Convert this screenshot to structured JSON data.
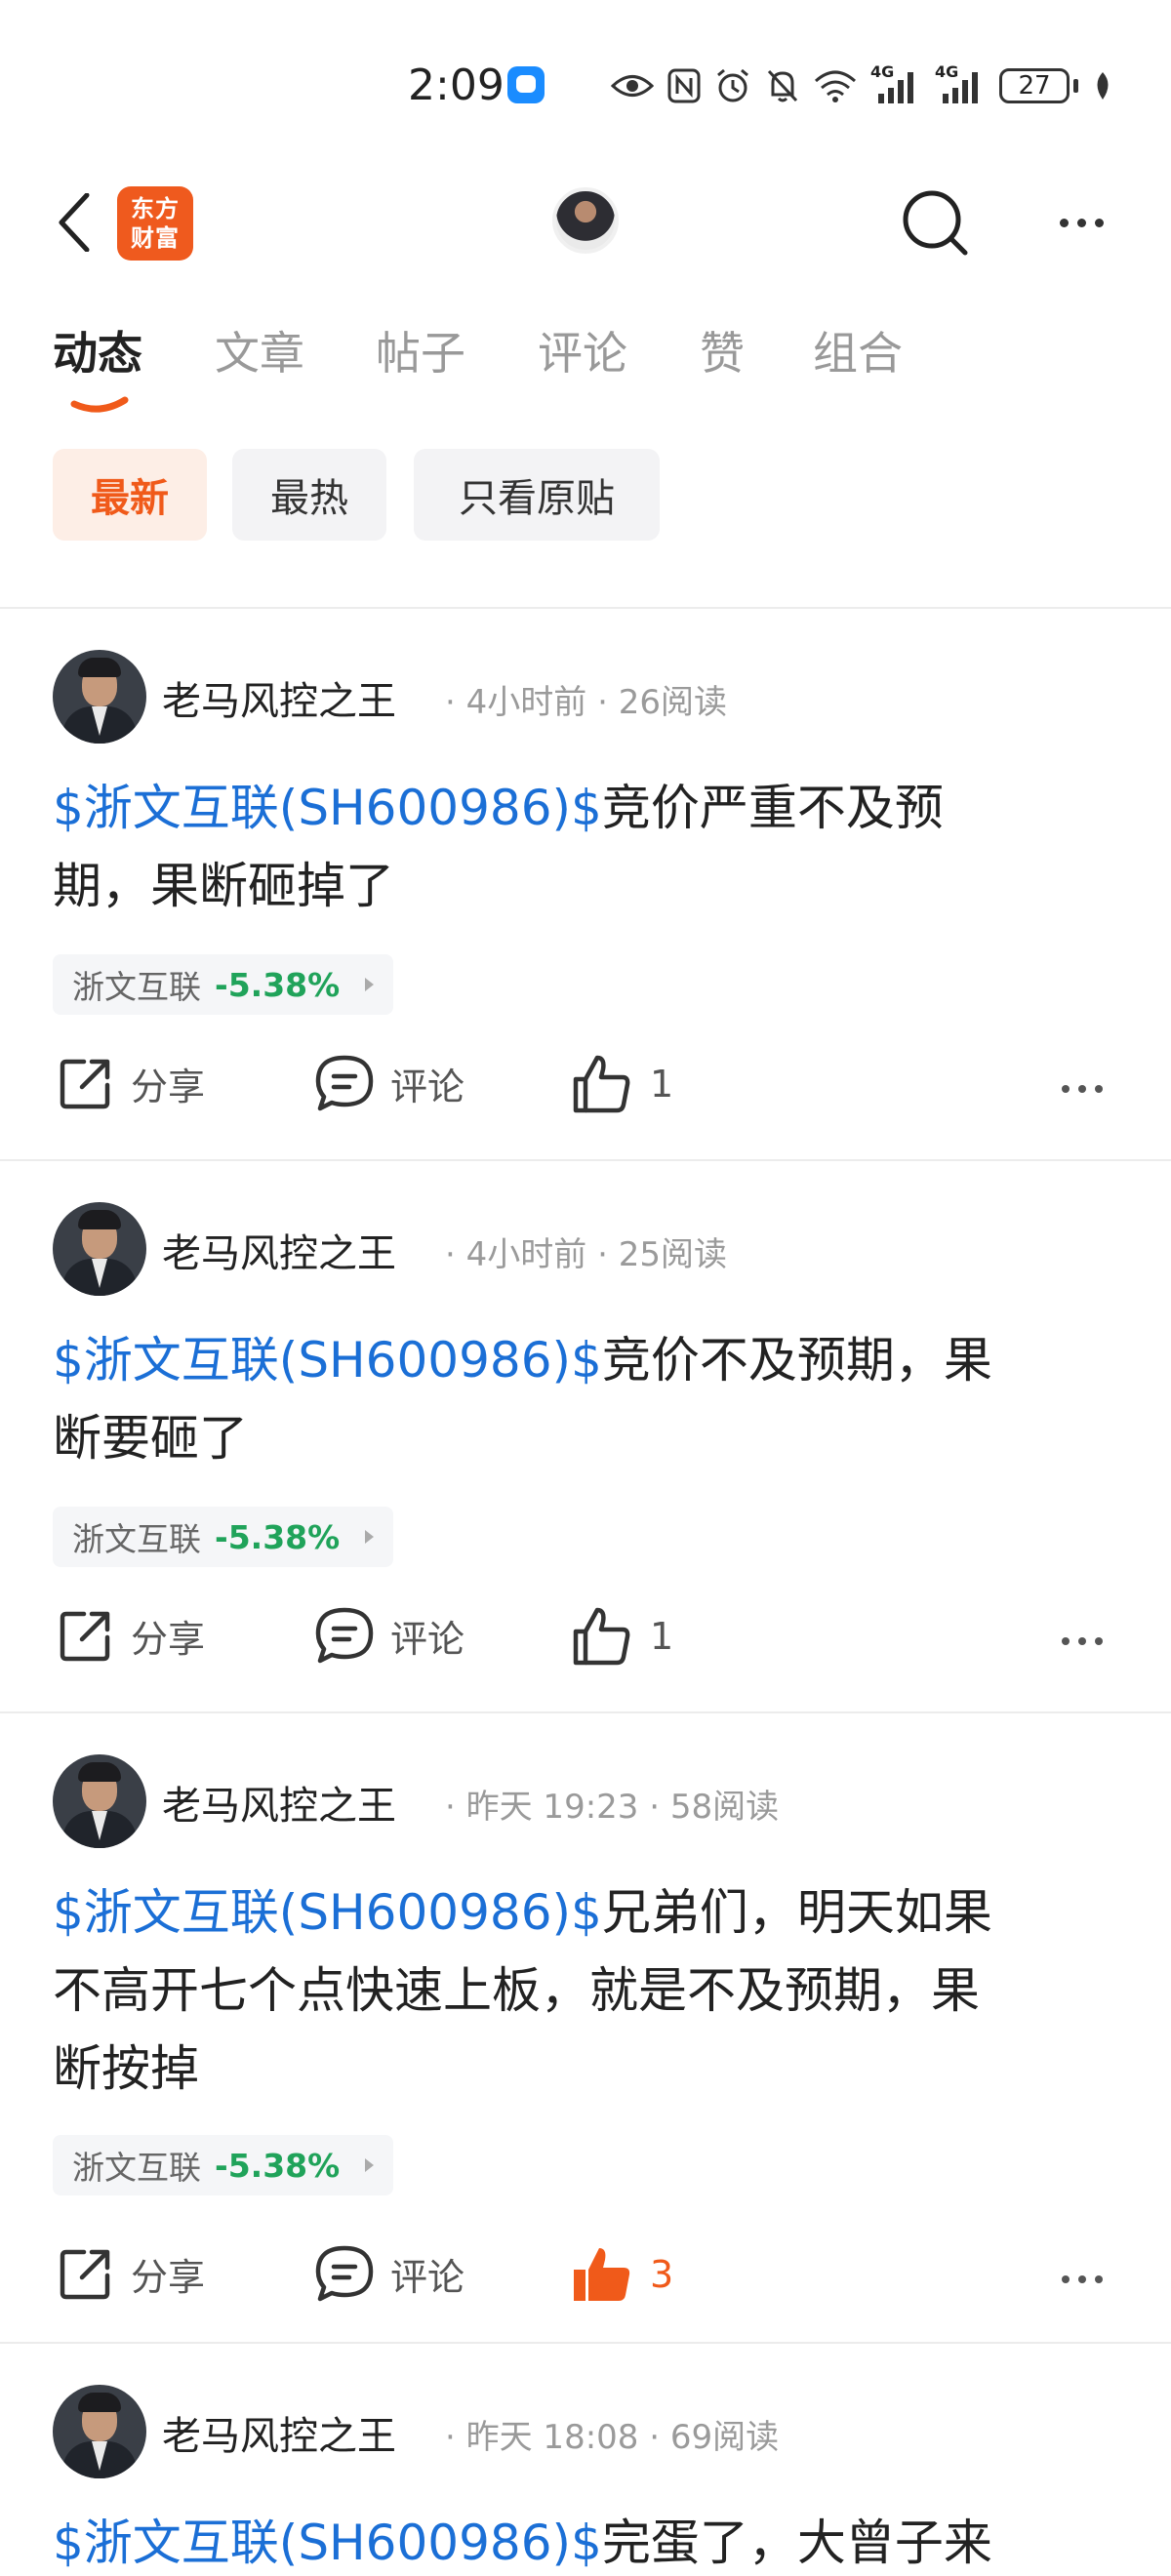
{
  "status_bar": {
    "time": "2:09",
    "battery": "27",
    "network_1": "4G",
    "network_2": "4G"
  },
  "nav": {
    "logo_line1": "东方",
    "logo_line2": "财富"
  },
  "tabs": [
    {
      "label": "动态",
      "active": true
    },
    {
      "label": "文章",
      "active": false
    },
    {
      "label": "帖子",
      "active": false
    },
    {
      "label": "评论",
      "active": false
    },
    {
      "label": "赞",
      "active": false
    },
    {
      "label": "组合",
      "active": false
    }
  ],
  "filters": [
    {
      "label": "最新",
      "active": true
    },
    {
      "label": "最热",
      "active": false
    },
    {
      "label": "只看原贴",
      "active": false
    }
  ],
  "actions": {
    "share": "分享",
    "comment": "评论"
  },
  "posts": [
    {
      "author": "老马风控之王",
      "time": "4小时前",
      "reads": "26阅读",
      "stock": "$浙文互联(SH600986)$",
      "text_line1": "竞价严重不及预",
      "text_line2": "期，果断砸掉了",
      "tag_name": "浙文互联",
      "tag_pct": "-5.38%",
      "likes": "1",
      "liked": false
    },
    {
      "author": "老马风控之王",
      "time": "4小时前",
      "reads": "25阅读",
      "stock": "$浙文互联(SH600986)$",
      "text_line1": "竞价不及预期，果",
      "text_line2": "断要砸了",
      "tag_name": "浙文互联",
      "tag_pct": "-5.38%",
      "likes": "1",
      "liked": false
    },
    {
      "author": "老马风控之王",
      "time": "昨天 19:23",
      "reads": "58阅读",
      "stock": "$浙文互联(SH600986)$",
      "text_line1": "兄弟们，明天如果",
      "text_line2": "不高开七个点快速上板，就是不及预期，果",
      "text_line3": "断按掉",
      "tag_name": "浙文互联",
      "tag_pct": "-5.38%",
      "likes": "3",
      "liked": true
    },
    {
      "author": "老马风控之王",
      "time": "昨天 18:08",
      "reads": "69阅读",
      "stock": "$浙文互联(SH600986)$",
      "text_line1": "完蛋了，大曾子来"
    }
  ]
}
